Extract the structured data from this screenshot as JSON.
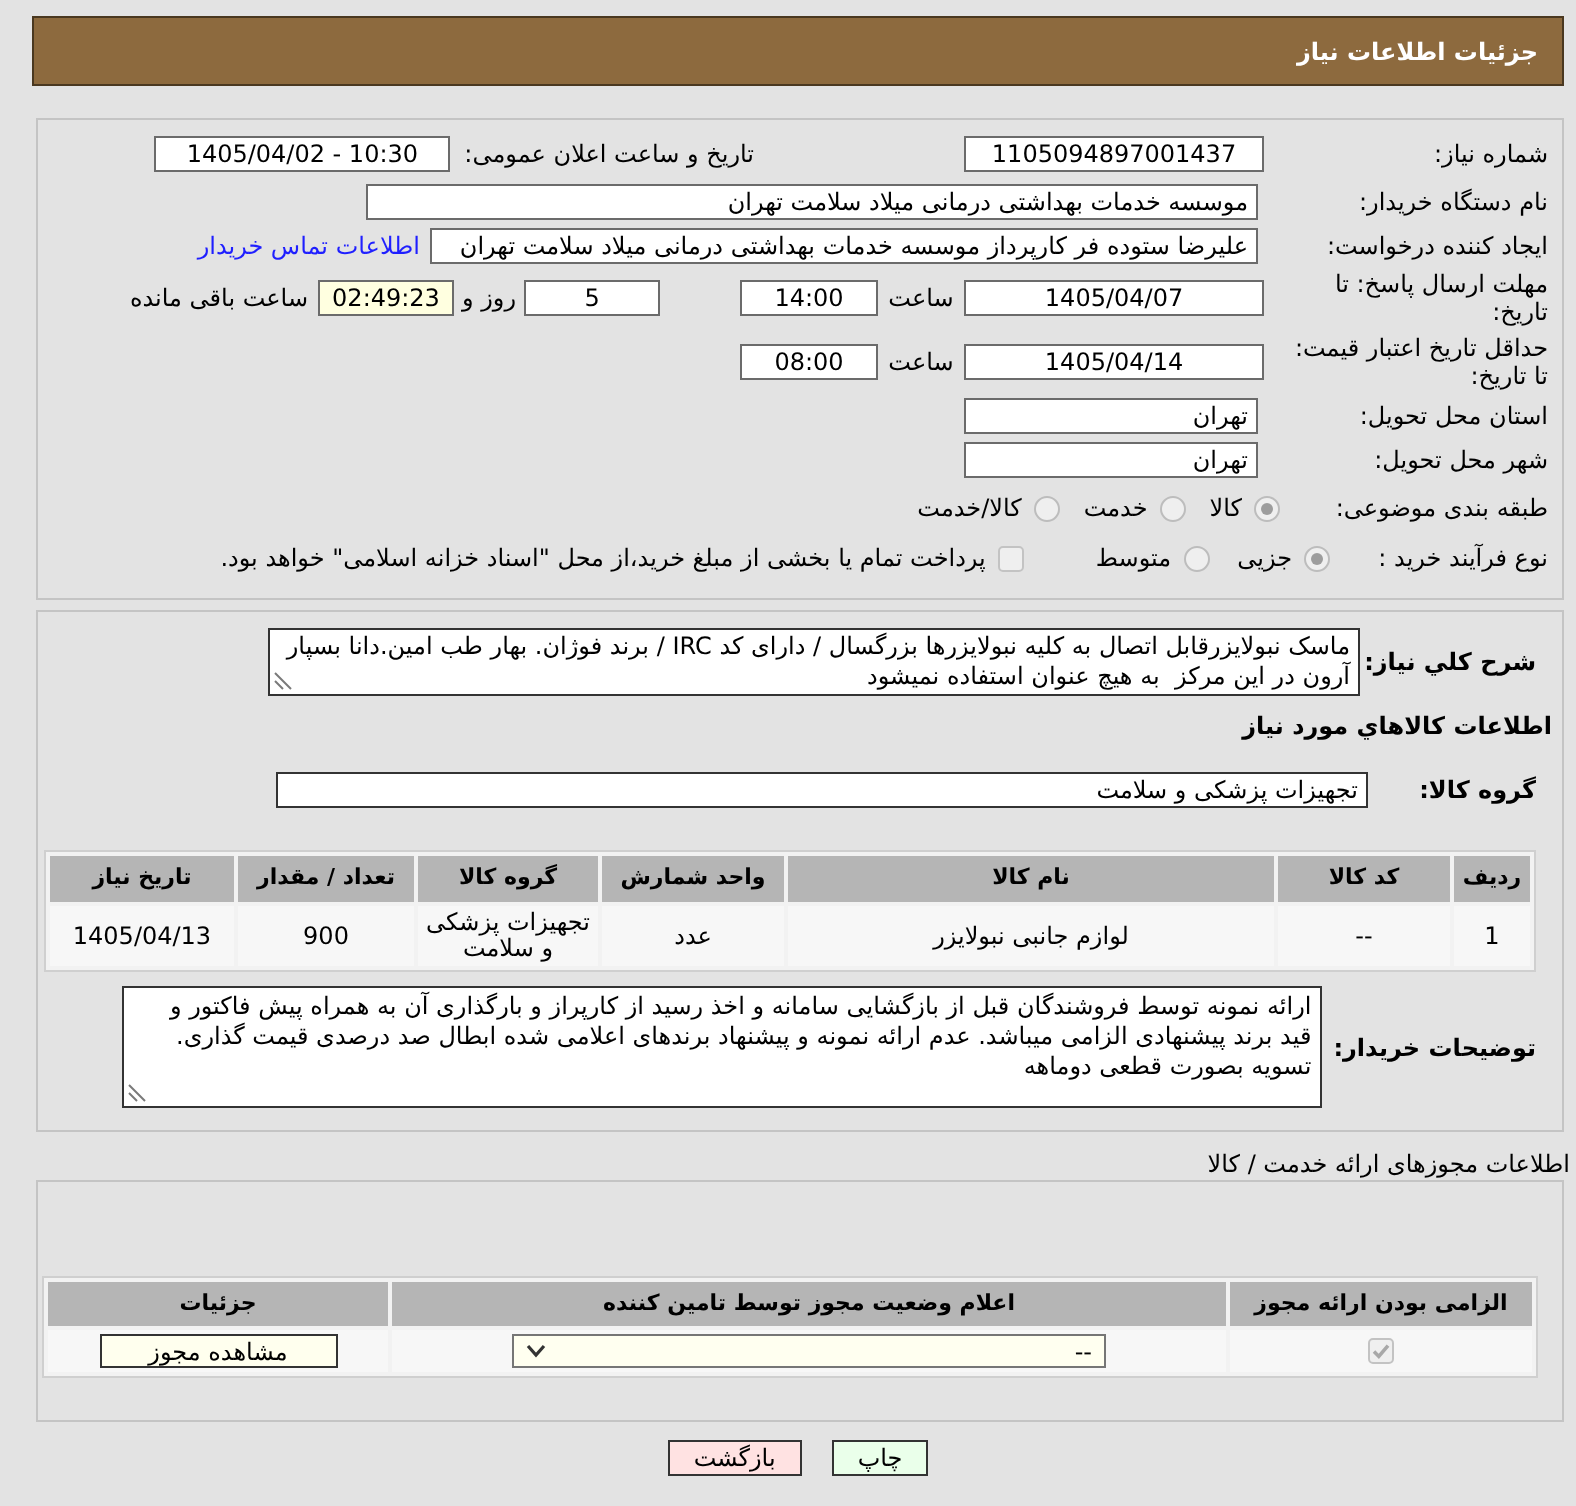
{
  "header": {
    "title": "جزئیات اطلاعات نیاز"
  },
  "request_info": {
    "need_number": {
      "label": "شماره نیاز:",
      "value": "1105094897001437"
    },
    "announcement": {
      "label": "تاریخ و ساعت اعلان عمومی:",
      "value": "1405/04/02 - 10:30"
    },
    "buyer_org": {
      "label": "نام دستگاه خریدار:",
      "value": "موسسه خدمات بهداشتی درمانی میلاد سلامت تهران"
    },
    "requester": {
      "label": "ایجاد کننده درخواست:",
      "value": "علیرضا ستوده فر کارپرداز موسسه خدمات بهداشتی درمانی میلاد سلامت تهران",
      "contact_link": "اطلاعات تماس خریدار"
    },
    "response_deadline": {
      "label": "مهلت ارسال پاسخ: تا تاریخ:",
      "date": "1405/04/07",
      "time_label": "ساعت",
      "time": "14:00",
      "days": "5",
      "days_label": "روز و",
      "remaining": "02:49:23",
      "remaining_label": "ساعت باقی مانده"
    },
    "price_validity": {
      "label": "حداقل تاریخ اعتبار قیمت: تا تاریخ:",
      "date": "1405/04/14",
      "time_label": "ساعت",
      "time": "08:00"
    },
    "delivery_province": {
      "label": "استان محل تحویل:",
      "value": "تهران"
    },
    "delivery_city": {
      "label": "شهر محل تحویل:",
      "value": "تهران"
    },
    "subject_category": {
      "label": "طبقه بندی موضوعی:",
      "options": [
        {
          "label": "کالا",
          "selected": true
        },
        {
          "label": "خدمت",
          "selected": false
        },
        {
          "label": "کالا/خدمت",
          "selected": false
        }
      ]
    },
    "purchase_process": {
      "label": "نوع فرآیند خرید :",
      "options": [
        {
          "label": "جزیی",
          "selected": true
        },
        {
          "label": "متوسط",
          "selected": false
        }
      ],
      "treasury_payment": {
        "label": "پرداخت تمام یا بخشی از مبلغ خرید،از محل \"اسناد خزانه اسلامی\" خواهد بود.",
        "checked": false
      }
    }
  },
  "needs": {
    "summary": {
      "label": "شرح کلي نياز:",
      "value": "ماسک نبولایزرقابل اتصال به کلیه نبولایزرها بزرگسال / دارای کد IRC / برند فوژان. بهار طب امین.دانا بسپار آرون در این مرکز  به هیچ عنوان استفاده نمیشود"
    },
    "items_heading": "اطلاعات کالاهاي مورد نياز",
    "goods_group": {
      "label": "گروه کالا:",
      "value": "تجهیزات پزشکی و سلامت"
    },
    "table": {
      "columns": [
        "ردیف",
        "کد کالا",
        "نام کالا",
        "واحد شمارش",
        "گروه کالا",
        "تعداد / مقدار",
        "تاریخ نیاز"
      ],
      "rows": [
        [
          "1",
          "--",
          "لوازم جانبی نبولایزر",
          "عدد",
          "تجهیزات پزشکی و سلامت",
          "900",
          "1405/04/13"
        ]
      ]
    },
    "buyer_notes": {
      "label": "توضیحات خریدار:",
      "value": "ارائه نمونه توسط فروشندگان قبل از بازگشایی سامانه و اخذ رسید از کارپراز و بارگذاری آن به همراه پیش فاکتور و قید برند پیشنهادی الزامی میباشد. عدم ارائه نمونه و پیشنهاد برندهای اعلامی شده ابطال صد درصدی قیمت گذاری. تسویه بصورت قطعی دوماهه"
    }
  },
  "licenses": {
    "heading": "اطلاعات مجوزهای ارائه خدمت / کالا",
    "columns": [
      "الزامی بودن ارائه مجوز",
      "اعلام وضعیت مجوز توسط تامین کننده",
      "جزئیات"
    ],
    "rows": [
      {
        "required": true,
        "status": "--",
        "details_button": "مشاهده مجوز"
      }
    ]
  },
  "actions": [
    {
      "label": "چاپ",
      "kind": "print"
    },
    {
      "label": "بازگشت",
      "kind": "back"
    }
  ]
}
